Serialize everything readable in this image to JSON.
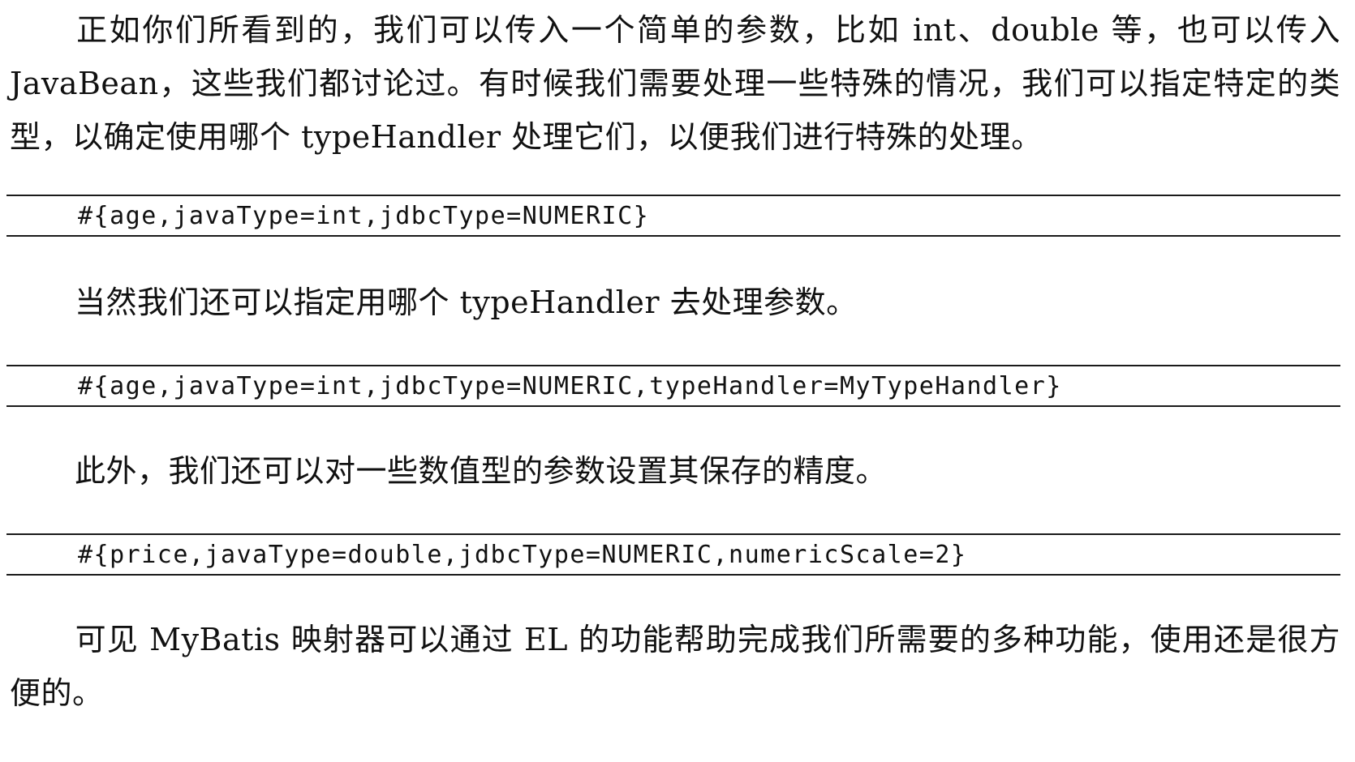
{
  "paragraphs": {
    "p1": "正如你们所看到的，我们可以传入一个简单的参数，比如 int、double 等，也可以传入 JavaBean，这些我们都讨论过。有时候我们需要处理一些特殊的情况，我们可以指定特定的类型，以确定使用哪个 typeHandler 处理它们，以便我们进行特殊的处理。",
    "p2": "当然我们还可以指定用哪个 typeHandler 去处理参数。",
    "p3": "此外，我们还可以对一些数值型的参数设置其保存的精度。",
    "p4": "可见 MyBatis 映射器可以通过 EL 的功能帮助完成我们所需要的多种功能，使用还是很方便的。"
  },
  "code": {
    "c1": "#{age,javaType=int,jdbcType=NUMERIC}",
    "c2": "#{age,javaType=int,jdbcType=NUMERIC,typeHandler=MyTypeHandler}",
    "c3": "#{price,javaType=double,jdbcType=NUMERIC,numericScale=2}"
  }
}
